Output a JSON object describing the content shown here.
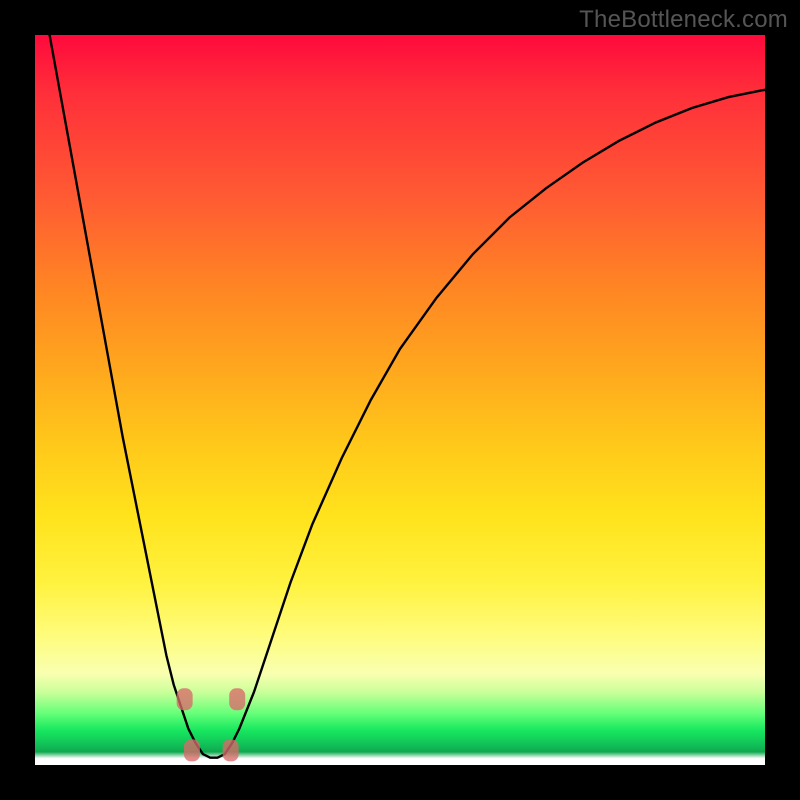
{
  "watermark": "TheBottleneck.com",
  "chart_data": {
    "type": "line",
    "title": "",
    "xlabel": "",
    "ylabel": "",
    "xlim": [
      0,
      100
    ],
    "ylim": [
      0,
      100
    ],
    "x": [
      0,
      2,
      4,
      6,
      8,
      10,
      12,
      14,
      16,
      18,
      19,
      20,
      21,
      22,
      23,
      24,
      25,
      26,
      27,
      28,
      30,
      32,
      35,
      38,
      42,
      46,
      50,
      55,
      60,
      65,
      70,
      75,
      80,
      85,
      90,
      95,
      100
    ],
    "values": [
      110,
      100,
      89,
      78,
      67,
      56,
      45,
      35,
      25,
      15,
      11,
      8,
      5,
      3,
      1.5,
      1,
      1,
      1.5,
      3,
      5,
      10,
      16,
      25,
      33,
      42,
      50,
      57,
      64,
      70,
      75,
      79,
      82.5,
      85.5,
      88,
      90,
      91.5,
      92.5
    ],
    "series": [
      {
        "name": "bottleneck-curve",
        "color": "#000000"
      }
    ],
    "markers": [
      {
        "x": 20.5,
        "y": 9.0
      },
      {
        "x": 27.7,
        "y": 9.0
      },
      {
        "x": 21.5,
        "y": 2.0
      },
      {
        "x": 26.8,
        "y": 2.0
      }
    ],
    "legend": false,
    "grid": false
  },
  "colors": {
    "curve": "#000000",
    "marker": "#d86a6a",
    "gradient_top": "#ff0a3c",
    "gradient_bottom_green": "#12c95a"
  }
}
